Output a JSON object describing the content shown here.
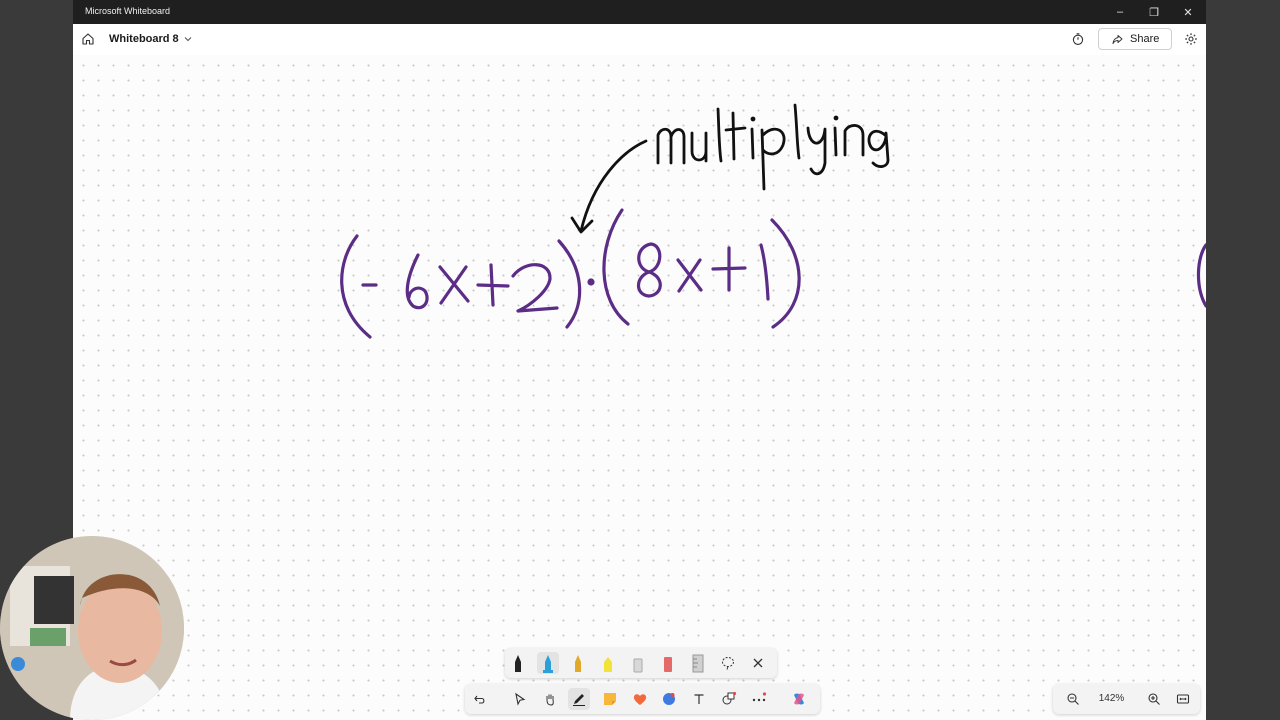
{
  "window": {
    "app_title": "Microsoft Whiteboard",
    "controls": {
      "minimize": "–",
      "restore": "❐",
      "close": "✕"
    }
  },
  "appbar": {
    "board_name": "Whiteboard 8",
    "share_label": "Share"
  },
  "canvas": {
    "ink_color": "#5b2d86",
    "annotation_color": "#111111",
    "handwritten_expression": "(-6x+2)·(8x+1)",
    "handwritten_annotation": "multiplying"
  },
  "pen_tray": {
    "tools": [
      "black-pen",
      "blue-pen",
      "yellow-pencil",
      "highlighter",
      "eraser",
      "red-pen",
      "ruler",
      "lasso",
      "close"
    ]
  },
  "main_toolbar": {
    "tools": [
      "undo",
      "select",
      "pan",
      "pen",
      "sticky-note",
      "reactions",
      "copilot-chat",
      "text",
      "shapes",
      "more",
      "copilot"
    ]
  },
  "zoom": {
    "level": "142%"
  },
  "colors": {
    "titlebar": "#1f1f1f",
    "canvas_bg": "#fcfcfc",
    "dot_grid": "#c8c8c8"
  }
}
